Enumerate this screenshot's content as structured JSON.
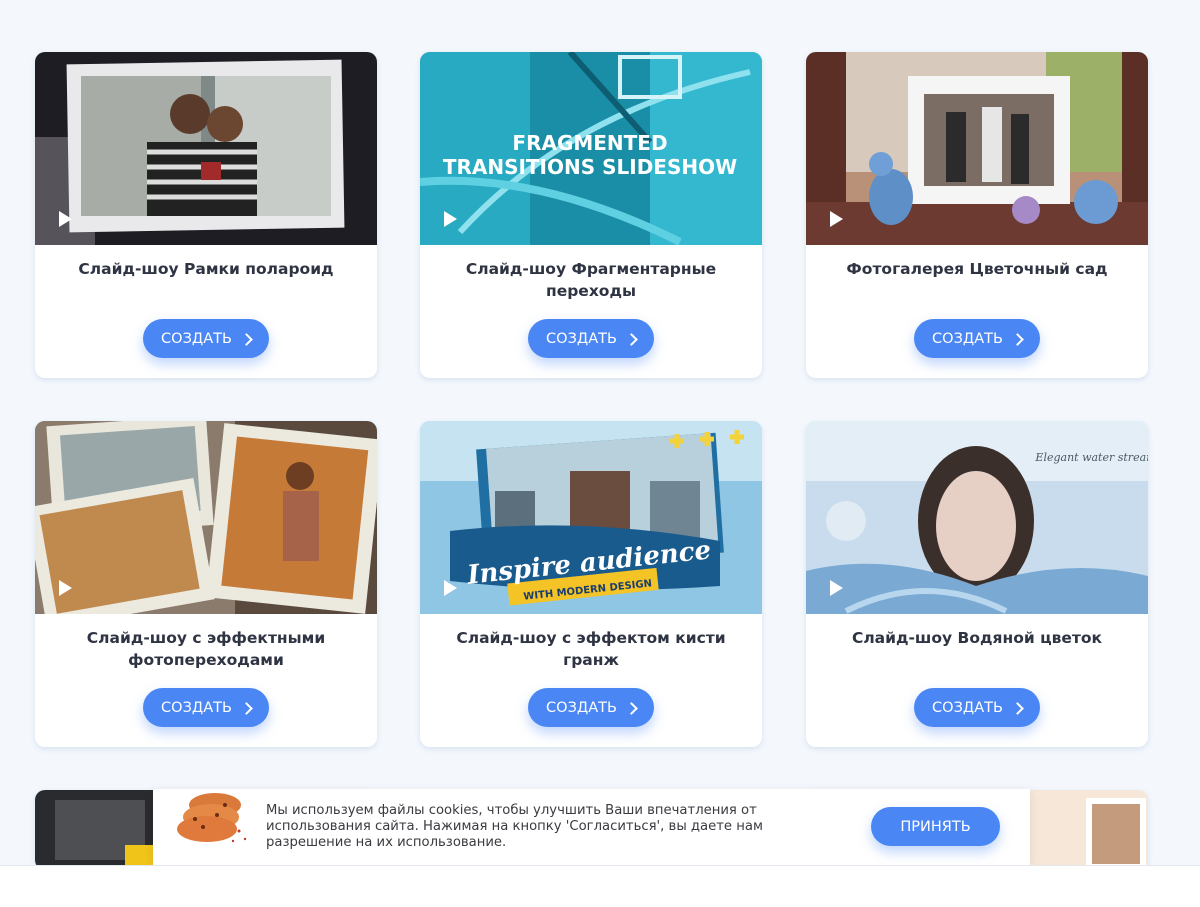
{
  "cards": [
    {
      "title": "Слайд-шоу Рамки полароид",
      "button": "СОЗДАТЬ"
    },
    {
      "title": "Слайд-шоу Фрагментарные переходы",
      "button": "СОЗДАТЬ",
      "overlay": [
        "FRAGMENTED",
        "TRANSITIONS SLIDESHOW"
      ]
    },
    {
      "title": "Фотогалерея Цветочный сад",
      "button": "СОЗДАТЬ"
    },
    {
      "title": "Слайд-шоу с эффектными фотопереходами",
      "button": "СОЗДАТЬ"
    },
    {
      "title": "Слайд-шоу с эффектом кисти гранж",
      "button": "СОЗДАТЬ",
      "overlay": [
        "Inspire audience",
        "WITH MODERN DESIGN"
      ]
    },
    {
      "title": "Слайд-шоу Водяной цветок",
      "button": "СОЗДАТЬ",
      "overlay": [
        "Elegant water stream"
      ]
    }
  ],
  "cookie_banner": {
    "text": "Мы используем файлы cookies, чтобы улучшить Ваши впечатления от использования сайта. Нажимая на кнопку 'Согласиться', вы даете нам разрешение на их использование.",
    "accept_label": "ПРИНЯТЬ"
  },
  "colors": {
    "accent": "#4a86f4",
    "page_bg": "#f4f8fd",
    "title_text": "#2f3443"
  },
  "icons": [
    "play-icon",
    "chevron-right-icon",
    "cookie-icon"
  ]
}
